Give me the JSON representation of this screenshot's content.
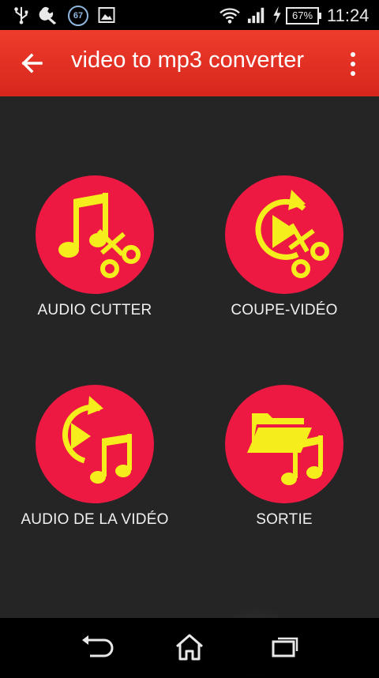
{
  "status_bar": {
    "notification_badge": "67",
    "battery_percent": "67%",
    "time": "11:24",
    "icons": [
      "usb-icon",
      "wrench-icon",
      "notification-67-icon",
      "image-icon",
      "wifi-icon",
      "signal-icon",
      "charging-bolt-icon",
      "battery-icon"
    ]
  },
  "app_bar": {
    "title": "video to mp3 converter",
    "back_icon": "back-arrow-icon",
    "menu_icon": "overflow-menu-icon"
  },
  "colors": {
    "app_bar": "#e5301f",
    "content_bg": "#252525",
    "tile_circle": "#ee1942",
    "tile_icon": "#f5ee1c"
  },
  "tiles": [
    {
      "label": "AUDIO CUTTER",
      "icon": "music-scissors-icon"
    },
    {
      "label": "COUPE-VIDÉO",
      "icon": "video-scissors-icon"
    },
    {
      "label": "AUDIO DE LA VIDÉO",
      "icon": "video-music-icon"
    },
    {
      "label": "SORTIE",
      "icon": "folder-music-icon"
    }
  ],
  "nav_bar": {
    "buttons": [
      "back-icon",
      "home-icon",
      "recent-apps-icon"
    ]
  }
}
